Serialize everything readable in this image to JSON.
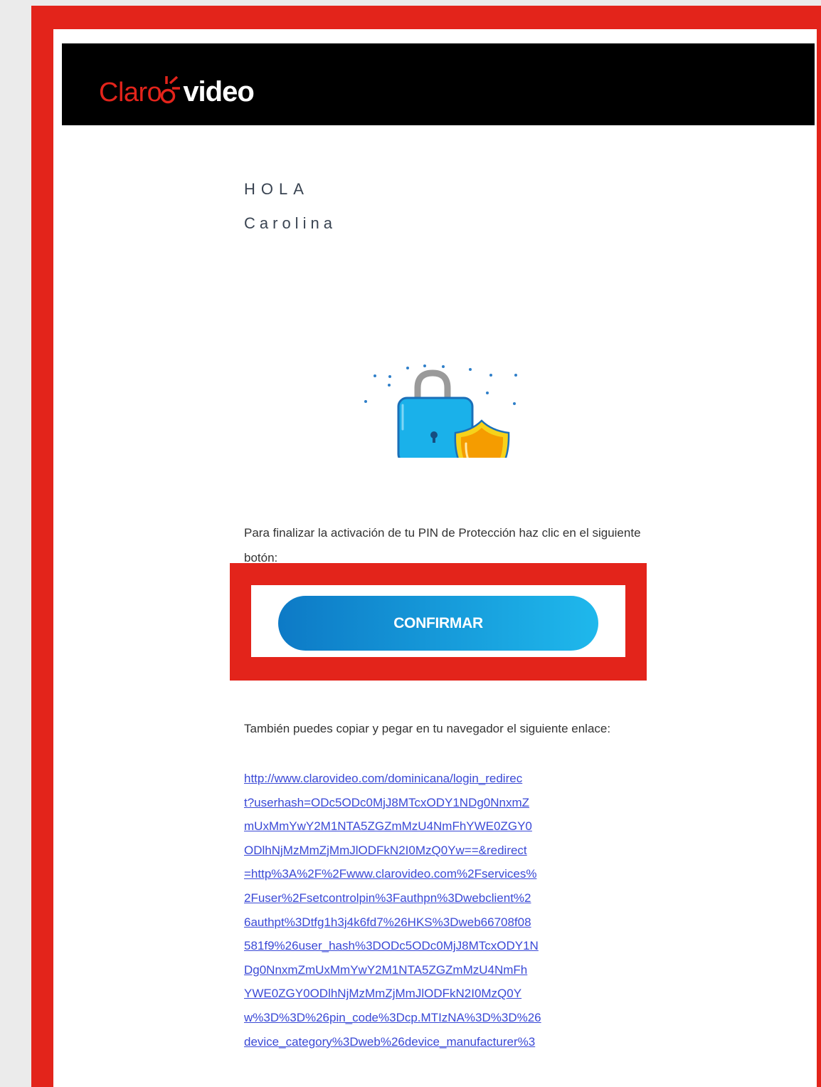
{
  "header": {
    "logo_claro": "Claro",
    "logo_video": "video",
    "logo_claro_color": "#e3241b"
  },
  "greeting": {
    "hello": "HOLA",
    "name": "Carolina"
  },
  "illustration": {
    "icon": "lock-shield-icon"
  },
  "instruction": "Para finalizar la activación de tu PIN de Protección haz clic en el siguiente botón:",
  "confirm_button": {
    "label": "CONFIRMAR",
    "gradient_start": "#0d7ac6",
    "gradient_end": "#1fb8ec"
  },
  "alt_text": "También puedes copiar y pegar en tu navegador el siguiente enlace:",
  "link_lines": [
    "http://www.clarovideo.com/dominicana/login_redirec",
    "t?userhash=ODc5ODc0MjJ8MTcxODY1NDg0NnxmZ",
    "mUxMmYwY2M1NTA5ZGZmMzU4NmFhYWE0ZGY0",
    "ODlhNjMzMmZjMmJlODFkN2I0MzQ0Yw==&redirect",
    "=http%3A%2F%2Fwww.clarovideo.com%2Fservices%",
    "2Fuser%2Fsetcontrolpin%3Fauthpn%3Dwebclient%2",
    "6authpt%3Dtfg1h3j4k6fd7%26HKS%3Dweb66708f08",
    "581f9%26user_hash%3DODc5ODc0MjJ8MTcxODY1N",
    "Dg0NnxmZmUxMmYwY2M1NTA5ZGZmMzU4NmFh",
    "YWE0ZGY0ODlhNjMzMmZjMmJlODFkN2I0MzQ0Y",
    "w%3D%3D%26pin_code%3Dcp.MTIzNA%3D%3D%26",
    "device_category%3Dweb%26device_manufacturer%3"
  ],
  "colors": {
    "highlight": "#e3241b",
    "link": "#3a49d6"
  }
}
